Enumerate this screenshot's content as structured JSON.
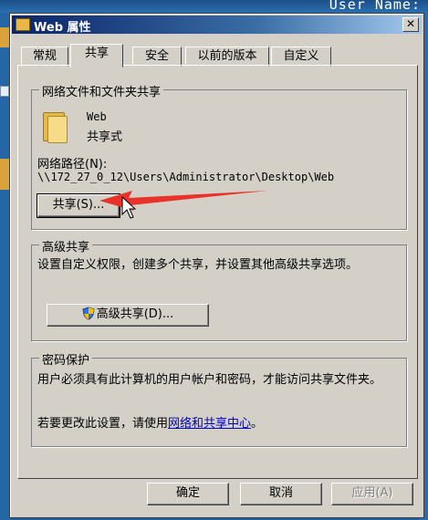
{
  "desktop": {
    "caption": "User Name:"
  },
  "dialog": {
    "title": "Web 属性",
    "close_symbol": "✕"
  },
  "tabs": [
    {
      "label": "常规"
    },
    {
      "label": "共享"
    },
    {
      "label": "安全"
    },
    {
      "label": "以前的版本"
    },
    {
      "label": "自定义"
    }
  ],
  "sharing": {
    "group_title": "网络文件和文件夹共享",
    "folder_name": "Web",
    "share_state": "共享式",
    "path_label": "网络路径(N):",
    "path_value": "\\\\172_27_0_12\\Users\\Administrator\\Desktop\\Web",
    "share_button": "共享(S)..."
  },
  "advanced": {
    "group_title": "高级共享",
    "description": "设置自定义权限，创建多个共享，并设置其他高级共享选项。",
    "button": "高级共享(D)..."
  },
  "password": {
    "group_title": "密码保护",
    "description": "用户必须具有此计算机的用户帐户和密码，才能访问共享文件夹。",
    "change_prefix": "若要更改此设置，请使用",
    "change_link": "网络和共享中心",
    "change_suffix": "。"
  },
  "footer": {
    "ok": "确定",
    "cancel": "取消",
    "apply": "应用(A)"
  },
  "colors": {
    "arrow": "#e8322a",
    "titlebar": "#0a246a",
    "link": "#0000cc"
  }
}
